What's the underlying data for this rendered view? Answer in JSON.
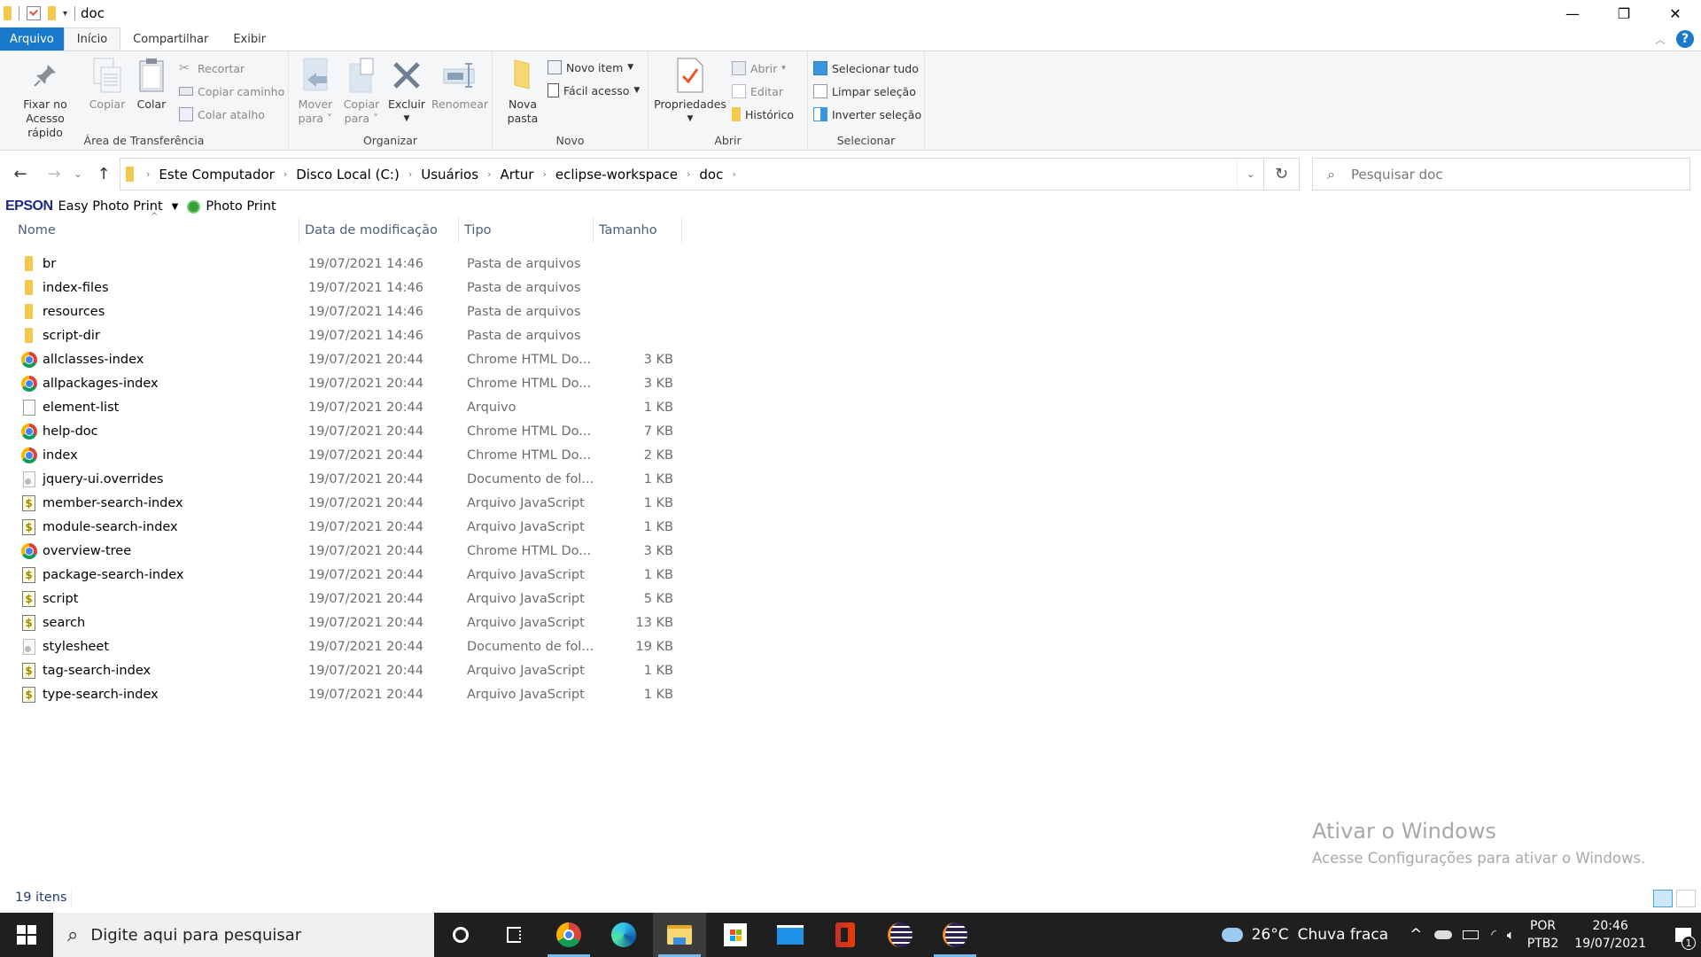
{
  "window": {
    "title": "doc",
    "controls": {
      "minimize": "—",
      "maximize": "❐",
      "close": "✕"
    }
  },
  "ribbon_tabs": [
    {
      "label": "Arquivo",
      "state": "file"
    },
    {
      "label": "Início",
      "state": "active"
    },
    {
      "label": "Compartilhar",
      "state": "normal"
    },
    {
      "label": "Exibir",
      "state": "normal"
    }
  ],
  "ribbon": {
    "clipboard": {
      "label": "Área de Transferência",
      "pin_line1": "Fixar no",
      "pin_line2": "Acesso rápido",
      "copy": "Copiar",
      "paste": "Colar",
      "cut": "Recortar",
      "copy_path": "Copiar caminho",
      "paste_shortcut": "Colar atalho"
    },
    "organize": {
      "label": "Organizar",
      "move_line1": "Mover",
      "move_line2": "para",
      "copyto_line1": "Copiar",
      "copyto_line2": "para",
      "delete": "Excluir",
      "rename": "Renomear"
    },
    "new": {
      "label": "Novo",
      "new_folder_line1": "Nova",
      "new_folder_line2": "pasta",
      "new_item": "Novo item",
      "easy_access": "Fácil acesso"
    },
    "open": {
      "label": "Abrir",
      "properties": "Propriedades",
      "open": "Abrir",
      "edit": "Editar",
      "history": "Histórico"
    },
    "select": {
      "label": "Selecionar",
      "select_all": "Selecionar tudo",
      "select_none": "Limpar seleção",
      "invert": "Inverter seleção"
    }
  },
  "navigation": {
    "back": "←",
    "forward": "→",
    "recent": "⌄",
    "up": "↑",
    "breadcrumb": [
      "Este Computador",
      "Disco Local (C:)",
      "Usuários",
      "Artur",
      "eclipse-workspace",
      "doc"
    ],
    "refresh": "↻",
    "search_placeholder": "Pesquisar doc"
  },
  "epson_bar": {
    "brand": "EPSON",
    "app": "Easy Photo Print",
    "photo_print": "Photo Print"
  },
  "columns": {
    "name": "Nome",
    "date": "Data de modificação",
    "type": "Tipo",
    "size": "Tamanho"
  },
  "files": [
    {
      "name": "br",
      "date": "19/07/2021 14:46",
      "type": "Pasta de arquivos",
      "size": "",
      "icon": "folder"
    },
    {
      "name": "index-files",
      "date": "19/07/2021 14:46",
      "type": "Pasta de arquivos",
      "size": "",
      "icon": "folder"
    },
    {
      "name": "resources",
      "date": "19/07/2021 14:46",
      "type": "Pasta de arquivos",
      "size": "",
      "icon": "folder"
    },
    {
      "name": "script-dir",
      "date": "19/07/2021 14:46",
      "type": "Pasta de arquivos",
      "size": "",
      "icon": "folder"
    },
    {
      "name": "allclasses-index",
      "date": "19/07/2021 20:44",
      "type": "Chrome HTML Do...",
      "size": "3 KB",
      "icon": "chrome"
    },
    {
      "name": "allpackages-index",
      "date": "19/07/2021 20:44",
      "type": "Chrome HTML Do...",
      "size": "3 KB",
      "icon": "chrome"
    },
    {
      "name": "element-list",
      "date": "19/07/2021 20:44",
      "type": "Arquivo",
      "size": "1 KB",
      "icon": "file"
    },
    {
      "name": "help-doc",
      "date": "19/07/2021 20:44",
      "type": "Chrome HTML Do...",
      "size": "7 KB",
      "icon": "chrome"
    },
    {
      "name": "index",
      "date": "19/07/2021 20:44",
      "type": "Chrome HTML Do...",
      "size": "2 KB",
      "icon": "chrome"
    },
    {
      "name": "jquery-ui.overrides",
      "date": "19/07/2021 20:44",
      "type": "Documento de fol...",
      "size": "1 KB",
      "icon": "css"
    },
    {
      "name": "member-search-index",
      "date": "19/07/2021 20:44",
      "type": "Arquivo JavaScript",
      "size": "1 KB",
      "icon": "js"
    },
    {
      "name": "module-search-index",
      "date": "19/07/2021 20:44",
      "type": "Arquivo JavaScript",
      "size": "1 KB",
      "icon": "js"
    },
    {
      "name": "overview-tree",
      "date": "19/07/2021 20:44",
      "type": "Chrome HTML Do...",
      "size": "3 KB",
      "icon": "chrome"
    },
    {
      "name": "package-search-index",
      "date": "19/07/2021 20:44",
      "type": "Arquivo JavaScript",
      "size": "1 KB",
      "icon": "js"
    },
    {
      "name": "script",
      "date": "19/07/2021 20:44",
      "type": "Arquivo JavaScript",
      "size": "5 KB",
      "icon": "js"
    },
    {
      "name": "search",
      "date": "19/07/2021 20:44",
      "type": "Arquivo JavaScript",
      "size": "13 KB",
      "icon": "js"
    },
    {
      "name": "stylesheet",
      "date": "19/07/2021 20:44",
      "type": "Documento de fol...",
      "size": "19 KB",
      "icon": "css"
    },
    {
      "name": "tag-search-index",
      "date": "19/07/2021 20:44",
      "type": "Arquivo JavaScript",
      "size": "1 KB",
      "icon": "js"
    },
    {
      "name": "type-search-index",
      "date": "19/07/2021 20:44",
      "type": "Arquivo JavaScript",
      "size": "1 KB",
      "icon": "js"
    }
  ],
  "status": {
    "count": "19 itens"
  },
  "watermark": {
    "title": "Ativar o Windows",
    "subtitle": "Acesse Configurações para ativar o Windows."
  },
  "taskbar": {
    "search_placeholder": "Digite aqui para pesquisar",
    "apps": [
      "cortana",
      "task-view",
      "chrome",
      "edge",
      "file-explorer",
      "microsoft-store",
      "mail",
      "office",
      "eclipse",
      "eclipse"
    ],
    "weather_temp": "26°C",
    "weather_desc": "Chuva fraca",
    "lang_top": "POR",
    "lang_bottom": "PTB2",
    "time": "20:46",
    "date": "19/07/2021",
    "notifications": "1"
  }
}
